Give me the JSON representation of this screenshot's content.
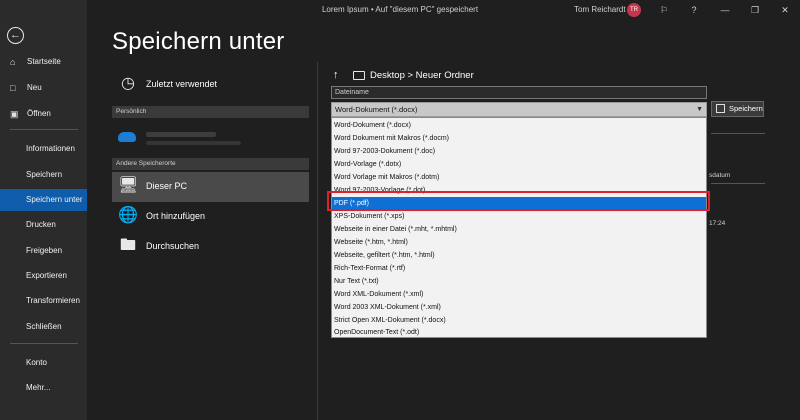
{
  "titlebar": {
    "title": "Lorem Ipsum • Auf \"diesem PC\" gespeichert",
    "user_name": "Tom Reichardt",
    "avatar_initials": "TR",
    "accent_color": "#c6354c"
  },
  "nav": {
    "items": [
      {
        "label": "Startseite",
        "icon": "home-icon"
      },
      {
        "label": "Neu",
        "icon": "new-document-icon"
      },
      {
        "label": "Öffnen",
        "icon": "open-folder-icon"
      },
      {
        "label": "Informationen"
      },
      {
        "label": "Speichern"
      },
      {
        "label": "Speichern unter",
        "active": true
      },
      {
        "label": "Drucken"
      },
      {
        "label": "Freigeben"
      },
      {
        "label": "Exportieren"
      },
      {
        "label": "Transformieren"
      },
      {
        "label": "Schließen"
      },
      {
        "label": "Konto"
      },
      {
        "label": "Mehr..."
      }
    ],
    "active_color": "#0f5caa"
  },
  "page": {
    "title": "Speichern unter"
  },
  "locations": {
    "recent_label": "Zuletzt verwendet",
    "personal_header": "Persönlich",
    "other_header": "Andere Speicherorte",
    "this_pc_label": "Dieser PC",
    "add_place_label": "Ort hinzufügen",
    "browse_label": "Durchsuchen"
  },
  "breadcrumb": {
    "path": "Desktop > Neuer Ordner"
  },
  "filename": {
    "placeholder": "Dateiname"
  },
  "filetype": {
    "selected": "Word-Dokument (*.docx)",
    "options": [
      "Word-Dokument (*.docx)",
      "Word Dokument mit Makros (*.docm)",
      "Word 97-2003-Dokument (*.doc)",
      "Word-Vorlage (*.dotx)",
      "Word Vorlage mit Makros (*.dotm)",
      "Word 97-2003-Vorlage (*.dot)",
      "PDF (*.pdf)",
      "XPS-Dokument (*.xps)",
      "Webseite in einer Datei (*.mht, *.mhtml)",
      "Webseite (*.htm, *.html)",
      "Webseite, gefiltert (*.htm, *.html)",
      "Rich-Text-Format (*.rtf)",
      "Nur Text (*.txt)",
      "Word XML-Dokument (*.xml)",
      "Word 2003 XML-Dokument (*.xml)",
      "Strict Open XML-Dokument (*.docx)",
      "OpenDocument-Text (*.odt)"
    ],
    "highlighted_index": 6,
    "highlight_color": "#0f6fd4"
  },
  "save_button": {
    "label": "Speichern"
  },
  "background_list": {
    "column_header_fragment": "sdatum",
    "time_fragment": "17:24"
  }
}
